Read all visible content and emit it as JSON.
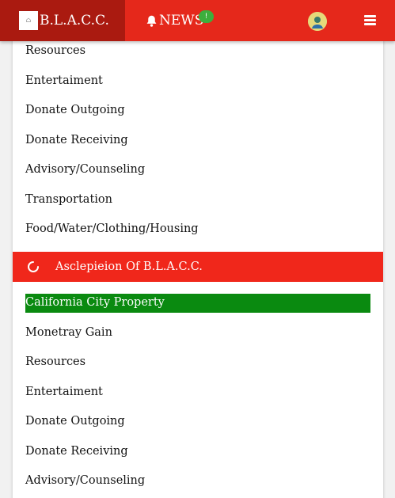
{
  "navbar": {
    "brand": "B.L.A.C.C.",
    "news_label": "NEWS",
    "news_badge": "!",
    "brand_color": "#aa1a10",
    "accent_color": "#e5281b"
  },
  "menu_top": {
    "items": [
      "Resources",
      "Entertaiment",
      "Donate Outgoing",
      "Donate Receiving",
      "Advisory/Counseling",
      "Transportation",
      "Food/Water/Clothing/Housing"
    ]
  },
  "section": {
    "title": "Asclepieion Of B.L.A.C.C.",
    "color": "#f0271b"
  },
  "menu_bottom": {
    "active_item": "California City Property",
    "active_color": "#0a8a10",
    "items": [
      "Monetray Gain",
      "Resources",
      "Entertaiment",
      "Donate Outgoing",
      "Donate Receiving",
      "Advisory/Counseling"
    ]
  },
  "icons": {
    "bell": "bell-icon",
    "avatar": "avatar-icon",
    "menu": "hamburger-icon",
    "spinner": "refresh-icon"
  }
}
